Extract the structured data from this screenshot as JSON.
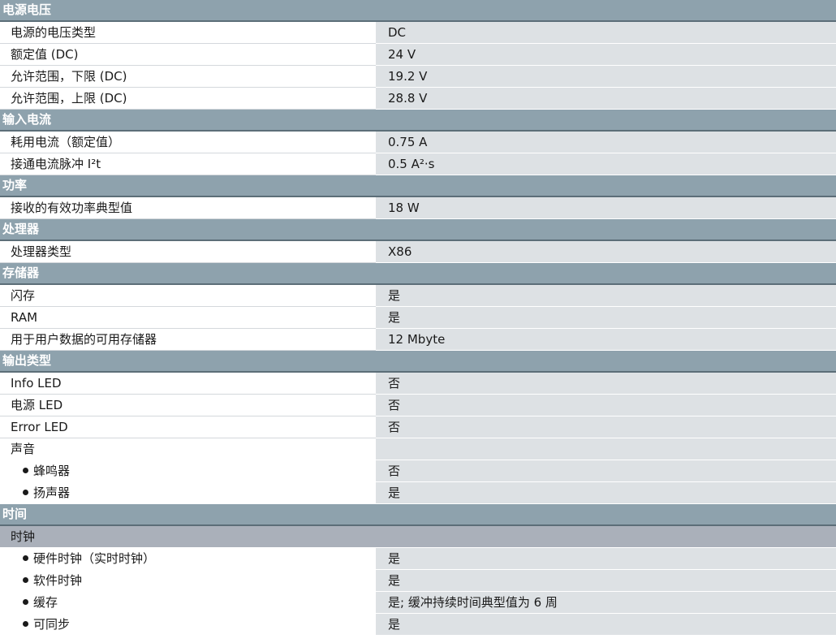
{
  "sections": {
    "power_supply": {
      "title": "电源电压",
      "voltage_type": {
        "label": "电源的电压类型",
        "value": "DC"
      },
      "rated_value": {
        "label": "额定值 (DC)",
        "value": "24 V"
      },
      "range_low": {
        "label": "允许范围，下限 (DC)",
        "value": "19.2 V"
      },
      "range_high": {
        "label": "允许范围，上限 (DC)",
        "value": "28.8 V"
      }
    },
    "input_current": {
      "title": "输入电流",
      "consumption": {
        "label": "耗用电流（额定值）",
        "value": "0.75 A"
      },
      "inrush": {
        "label": "接通电流脉冲 I²t",
        "value": "0.5 A²·s"
      }
    },
    "power": {
      "title": "功率",
      "active_power": {
        "label": "接收的有效功率典型值",
        "value": "18 W"
      }
    },
    "processor": {
      "title": "处理器",
      "type": {
        "label": "处理器类型",
        "value": "X86"
      }
    },
    "memory": {
      "title": "存储器",
      "flash": {
        "label": "闪存",
        "value": "是"
      },
      "ram": {
        "label": "RAM",
        "value": "是"
      },
      "user_memory": {
        "label": "用于用户数据的可用存储器",
        "value": "12 Mbyte"
      }
    },
    "output_type": {
      "title": "输出类型",
      "info_led": {
        "label": "Info LED",
        "value": "否"
      },
      "power_led": {
        "label": "电源 LED",
        "value": "否"
      },
      "error_led": {
        "label": "Error LED",
        "value": "否"
      },
      "sound": {
        "label": "声音",
        "value": ""
      },
      "buzzer": {
        "label": "蜂鸣器",
        "value": "否"
      },
      "speaker": {
        "label": "扬声器",
        "value": "是"
      }
    },
    "time": {
      "title": "时间",
      "clock": {
        "label": "时钟"
      },
      "hw_clock": {
        "label": "硬件时钟（实时时钟）",
        "value": "是"
      },
      "sw_clock": {
        "label": "软件时钟",
        "value": "是"
      },
      "buffer": {
        "label": "缓存",
        "value": "是; 缓冲持续时间典型值为 6 周"
      },
      "sync": {
        "label": "可同步",
        "value": "是"
      }
    }
  }
}
